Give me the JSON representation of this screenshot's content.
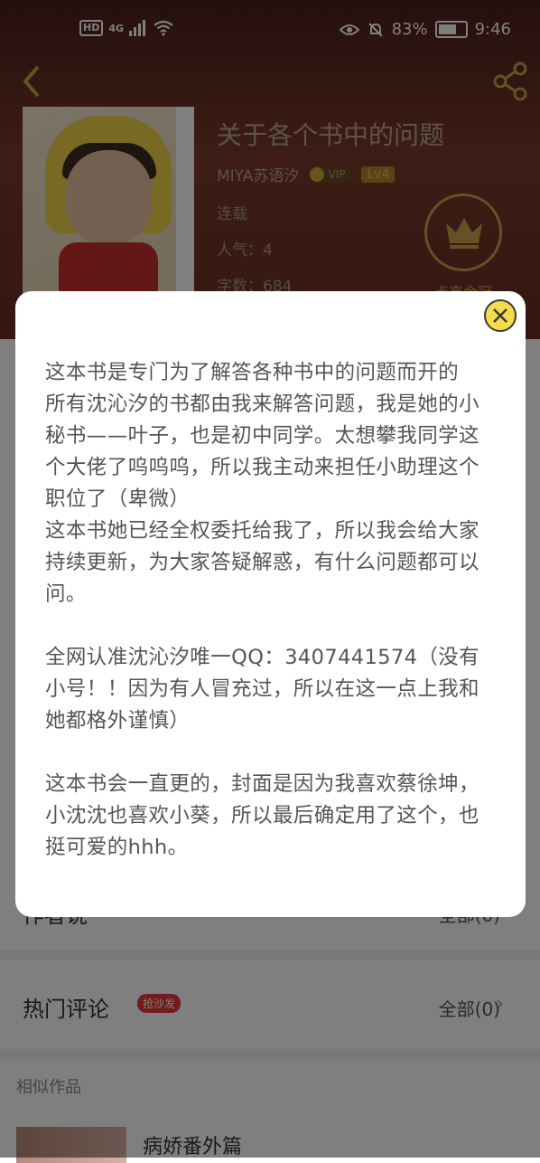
{
  "status_bar": {
    "hd": "HD",
    "network": "4G",
    "battery_percent": "83%",
    "battery_level": 0.83,
    "time": "9:46"
  },
  "book": {
    "title": "关于各个书中的问题",
    "author": "MIYA苏语汐",
    "vip_label": "VIP",
    "level": "Lv4",
    "status": "连载",
    "popularity": "人气：4",
    "word_count": "字数：684",
    "crown_label": "点亮金冠"
  },
  "page_lower": {
    "row1_label": "作者说",
    "row1_right": "全部(0)",
    "comments_title": "热门评论",
    "comments_tag": "抢沙发",
    "comments_all": "全部(0)",
    "similar_title": "相似作品",
    "similar_item": "病娇番外篇"
  },
  "dialog": {
    "paragraphs": [
      "这本书是专门为了解答各种书中的问题而开的",
      "所有沈沁汐的书都由我来解答问题，我是她的小秘书——叶子，也是初中同学。太想攀我同学这个大佬了呜呜呜，所以我主动来担任小助理这个职位了（卑微）",
      "这本书她已经全权委托给我了，所以我会给大家持续更新，为大家答疑解惑，有什么问题都可以问。",
      "全网认准沈沁汐唯一QQ：3407441574（没有小号！！因为有人冒充过，所以在这一点上我和她都格外谨慎）",
      "这本书会一直更的，封面是因为我喜欢蔡徐坤，小沈沈也喜欢小葵，所以最后确定用了这个，也挺可爱的hhh。"
    ]
  },
  "colors": {
    "accent_gold": "#c9a24a",
    "close_yellow": "#f5dc4a",
    "tag_red": "#e23b3b"
  },
  "icons": [
    "back-arrow-icon",
    "share-icon",
    "crown-icon",
    "close-icon",
    "wifi-icon",
    "signal-icon",
    "eye-icon",
    "bell-off-icon",
    "battery-icon",
    "chevron-right-icon"
  ]
}
